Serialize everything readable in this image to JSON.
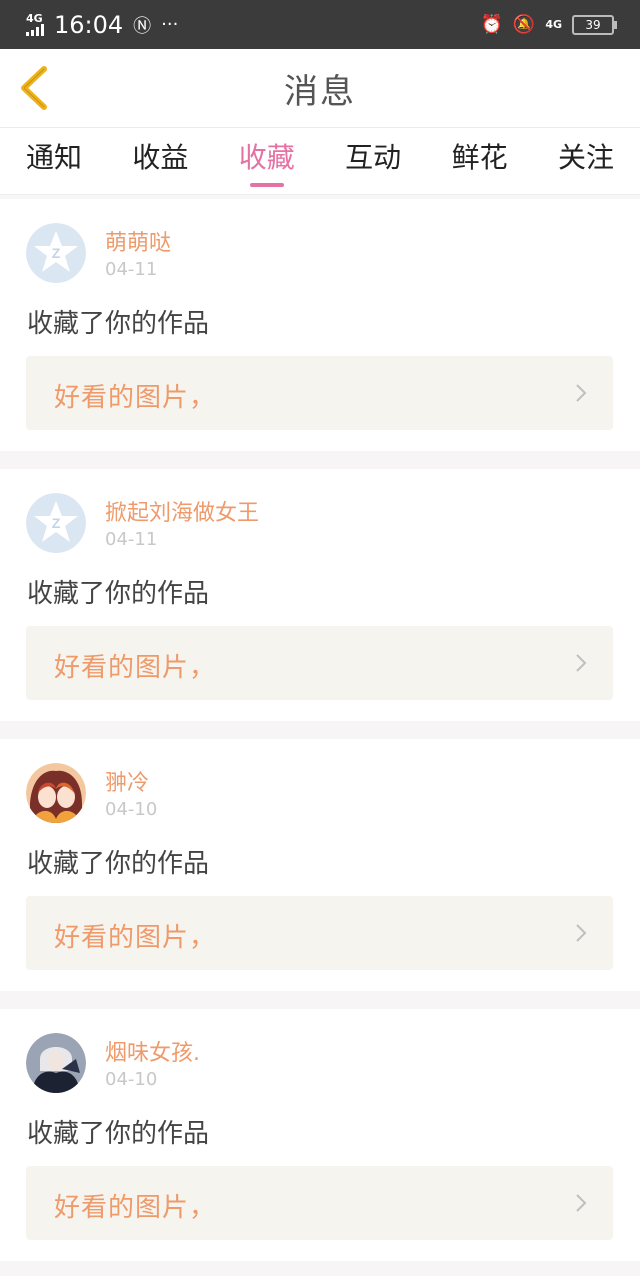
{
  "status_bar": {
    "network_left": "4G",
    "time": "16:04",
    "extra_icon": "nfc-icon",
    "more": "···",
    "network_right": "4G",
    "battery": "39"
  },
  "header": {
    "title": "消息",
    "back_icon": "chevron-left-icon"
  },
  "tabs": [
    {
      "label": "通知",
      "active": false
    },
    {
      "label": "收益",
      "active": false
    },
    {
      "label": "收藏",
      "active": true
    },
    {
      "label": "互动",
      "active": false
    },
    {
      "label": "鲜花",
      "active": false
    },
    {
      "label": "关注",
      "active": false
    }
  ],
  "colors": {
    "accent": "#e572a5",
    "name": "#ef9a6a",
    "back_icon": "#f0b21a"
  },
  "messages": [
    {
      "name": "萌萌哒",
      "date": "04-11",
      "action": "收藏了你的作品",
      "work": "好看的图片，",
      "avatar": "qq-default"
    },
    {
      "name": "掀起刘海做女王",
      "date": "04-11",
      "action": "收藏了你的作品",
      "work": "好看的图片，",
      "avatar": "qq-default"
    },
    {
      "name": "翀冷",
      "date": "04-10",
      "action": "收藏了你的作品",
      "work": "好看的图片，",
      "avatar": "anime-girls"
    },
    {
      "name": "烟味女孩.",
      "date": "04-10",
      "action": "收藏了你的作品",
      "work": "好看的图片，",
      "avatar": "dark-portrait"
    }
  ]
}
